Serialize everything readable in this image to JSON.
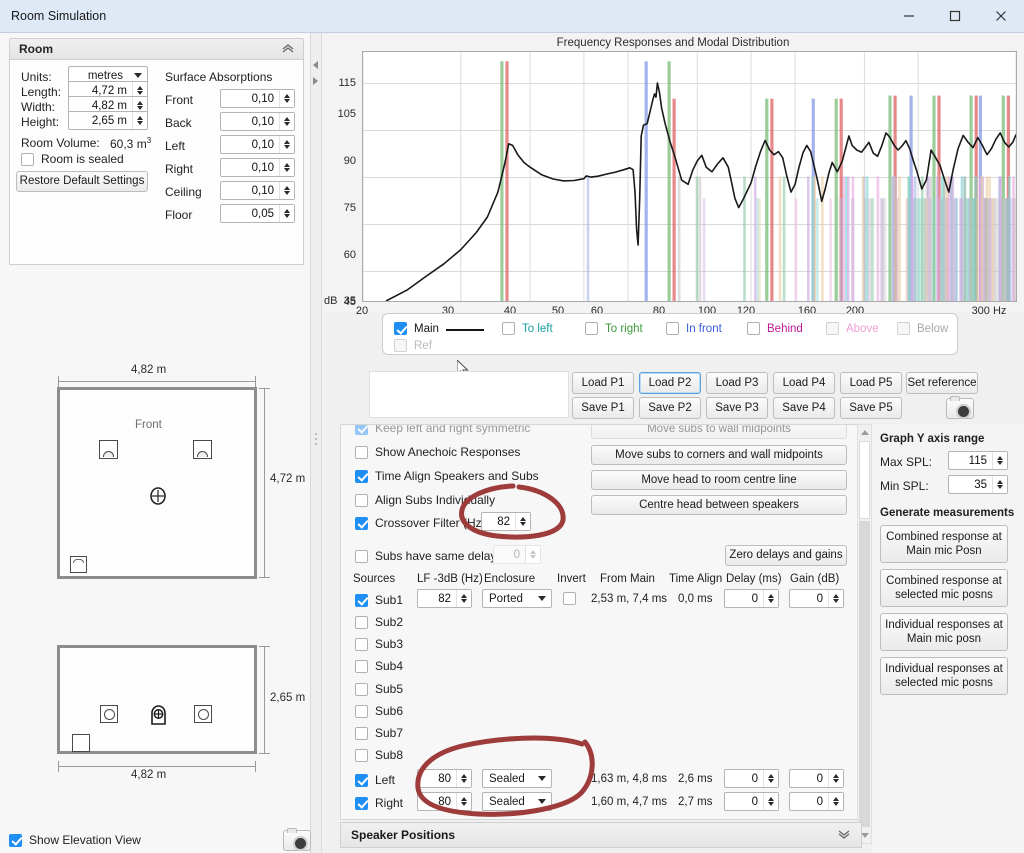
{
  "window": {
    "title": "Room Simulation",
    "minimize": "minimize-button",
    "maximize": "maximize-button",
    "close": "close-button"
  },
  "room_group": {
    "title": "Room",
    "collapse_icon": "chevron-up-icon",
    "units_label": "Units:",
    "units_value": "metres",
    "length_label": "Length:",
    "length_value": "4,72 m",
    "width_label": "Width:",
    "width_value": "4,82 m",
    "height_label": "Height:",
    "height_value": "2,65 m",
    "volume_label": "Room Volume:",
    "volume_value": "60,3 m",
    "volume_exp": "3",
    "sealed_label": "Room is sealed",
    "sealed_checked": false,
    "restore_label": "Restore Default Settings",
    "absorptions_title": "Surface Absorptions",
    "absorptions": [
      {
        "label": "Front",
        "value": "0,10"
      },
      {
        "label": "Back",
        "value": "0,10"
      },
      {
        "label": "Left",
        "value": "0,10"
      },
      {
        "label": "Right",
        "value": "0,10"
      },
      {
        "label": "Ceiling",
        "value": "0,10"
      },
      {
        "label": "Floor",
        "value": "0,05"
      }
    ]
  },
  "plan_view": {
    "width_dim": "4,82 m",
    "depth_dim": "4,72 m",
    "front_label": "Front"
  },
  "elevation_view": {
    "height_dim": "2,65 m",
    "width_dim": "4,82 m"
  },
  "show_elevation": {
    "label": "Show Elevation View",
    "checked": true
  },
  "chart_data": {
    "type": "line",
    "title": "Frequency Responses and Modal Distribution",
    "xlabel": "",
    "ylabel": "dB",
    "x_unit": "Hz",
    "xscale": "log",
    "xlim": [
      20,
      300
    ],
    "ylim": [
      35,
      115
    ],
    "grid": true,
    "yticks": [
      115,
      105,
      90,
      75,
      60,
      45,
      35
    ],
    "xticks": [
      20,
      30,
      40,
      50,
      60,
      80,
      100,
      120,
      160,
      200,
      300
    ],
    "xtick_labels": [
      "20",
      "30",
      "40",
      "50",
      "60",
      "80",
      "100",
      "120",
      "160",
      "200",
      "300 Hz"
    ],
    "series": [
      {
        "name": "Main",
        "color": "#1a1a1a",
        "x": [
          22,
          24,
          26,
          28,
          30,
          32,
          33.5,
          35,
          36,
          36.6,
          37.2,
          38,
          39,
          40,
          42,
          44,
          46,
          48,
          50,
          50.5,
          51.5,
          53,
          55,
          57,
          59,
          60.5,
          61.3,
          61.8,
          62.2,
          62.6,
          63,
          63.4,
          64,
          65,
          66,
          66.6,
          67,
          67.4,
          67.8,
          68.4,
          69,
          70,
          71.5,
          73,
          75,
          77,
          78.5,
          80,
          81.5,
          83,
          85,
          87,
          89,
          91,
          92.5,
          93.5,
          95,
          97,
          100,
          102,
          104,
          106,
          108,
          110,
          112,
          114,
          116,
          118,
          120,
          122,
          124,
          126,
          128,
          130,
          132,
          134,
          136,
          138,
          140,
          143,
          146,
          148,
          150,
          152,
          155,
          158,
          160,
          163,
          166,
          169,
          172,
          175,
          178,
          181,
          184,
          187,
          190,
          193,
          196,
          199,
          203,
          207,
          211,
          215,
          219,
          223,
          227,
          231,
          236,
          241,
          246,
          251,
          256,
          261,
          266,
          271,
          276,
          281,
          286,
          291,
          296,
          300
        ],
        "y": [
          35,
          38.5,
          43,
          47,
          51.5,
          57,
          62,
          70,
          79,
          85.5,
          85,
          82,
          79.5,
          78,
          75.5,
          74.2,
          73.6,
          73.7,
          74.3,
          75.2,
          74.8,
          75.1,
          75.8,
          76.4,
          77.2,
          77.8,
          77.2,
          70,
          58,
          53,
          68,
          88,
          91.5,
          92,
          97,
          100,
          101.5,
          100.5,
          105,
          102,
          97,
          92,
          86,
          81,
          73.8,
          72.5,
          77,
          80,
          81.8,
          78,
          76.5,
          79,
          81,
          78,
          72,
          68,
          65,
          68,
          73,
          78.5,
          83,
          86.6,
          83.5,
          82,
          83,
          81,
          75,
          70,
          72.5,
          78,
          82.6,
          85,
          83,
          78,
          73,
          67,
          71,
          76,
          79.5,
          76.5,
          80,
          84,
          88,
          85,
          83.5,
          82.8,
          84,
          86,
          82.5,
          81.5,
          85,
          89,
          87.5,
          85,
          83.5,
          84.8,
          86.5,
          84,
          80,
          76.5,
          71,
          74,
          83.5,
          81,
          78.5,
          74,
          70,
          77,
          84,
          88.2,
          86,
          84.3,
          87.5,
          85,
          82,
          84,
          87,
          89,
          86,
          84.5,
          86,
          88.5,
          87.5
        ]
      }
    ],
    "modes_note": "Vertical coloured bars = room modal distribution (axial red/green/blue, tangential & oblique in pastel colours)"
  },
  "legend": {
    "items": [
      {
        "label": "Main",
        "color": "#111111",
        "checked": true,
        "enabled": true,
        "line": true
      },
      {
        "label": "To left",
        "color": "#16a2a2",
        "checked": false,
        "enabled": true,
        "line": false
      },
      {
        "label": "To right",
        "color": "#3d9b3d",
        "checked": false,
        "enabled": true,
        "line": false
      },
      {
        "label": "In front",
        "color": "#3b5bd9",
        "checked": false,
        "enabled": true,
        "line": false
      },
      {
        "label": "Behind",
        "color": "#c0189a",
        "checked": false,
        "enabled": true,
        "line": false
      },
      {
        "label": "Above",
        "color": "#f29ad6",
        "checked": false,
        "enabled": false,
        "line": false
      },
      {
        "label": "Below",
        "color": "#9b9b9b",
        "checked": false,
        "enabled": false,
        "line": false
      },
      {
        "label": "Ref",
        "color": "#b3b3b3",
        "checked": false,
        "enabled": false,
        "line": false
      }
    ]
  },
  "preset_buttons": {
    "load": [
      "Load P1",
      "Load P2",
      "Load P3",
      "Load P4",
      "Load P5"
    ],
    "save": [
      "Save P1",
      "Save P2",
      "Save P3",
      "Save P4",
      "Save P5"
    ],
    "set_reference": "Set reference",
    "selected_load": "Load P2",
    "camera_icon": "camera-icon"
  },
  "settings": {
    "keep_symmetric": {
      "label": "Keep left and right symmetric",
      "checked": true
    },
    "show_anechoic": {
      "label": "Show Anechoic Responses",
      "checked": false
    },
    "time_align": {
      "label": "Time Align Speakers and Subs",
      "checked": true
    },
    "align_individually": {
      "label": "Align Subs Individually",
      "checked": false
    },
    "crossover": {
      "label": "Crossover Filter (Hz)",
      "checked": true,
      "value": "82"
    },
    "same_delay": {
      "label": "Subs have same delay",
      "checked": false,
      "value": "0"
    },
    "buttons": [
      "Move subs to wall midpoints",
      "Move subs to corners and wall midpoints",
      "Move head to room centre line",
      "Centre head between speakers"
    ],
    "zero_delays": "Zero delays and gains"
  },
  "sources_table": {
    "headers": [
      "Sources",
      "LF -3dB (Hz)",
      "Enclosure",
      "Invert",
      "From Main",
      "Time Align",
      "Delay (ms)",
      "Gain (dB)"
    ],
    "rows": [
      {
        "name": "Sub1",
        "checked": true,
        "lf": "82",
        "enclosure": "Ported",
        "invert": false,
        "from_main": "2,53 m, 7,4 ms",
        "time_align": "0,0 ms",
        "delay": "0",
        "gain": "0",
        "has_controls": true
      },
      {
        "name": "Sub2",
        "checked": false,
        "has_controls": false
      },
      {
        "name": "Sub3",
        "checked": false,
        "has_controls": false
      },
      {
        "name": "Sub4",
        "checked": false,
        "has_controls": false
      },
      {
        "name": "Sub5",
        "checked": false,
        "has_controls": false
      },
      {
        "name": "Sub6",
        "checked": false,
        "has_controls": false
      },
      {
        "name": "Sub7",
        "checked": false,
        "has_controls": false
      },
      {
        "name": "Sub8",
        "checked": false,
        "has_controls": false
      },
      {
        "name": "Left",
        "checked": true,
        "lf": "80",
        "enclosure": "Sealed",
        "invert": null,
        "from_main": "1,63 m, 4,8 ms",
        "time_align": "2,6 ms",
        "delay": "0",
        "gain": "0",
        "has_controls": true
      },
      {
        "name": "Right",
        "checked": true,
        "lf": "80",
        "enclosure": "Sealed",
        "invert": null,
        "from_main": "1,60 m, 4,7 ms",
        "time_align": "2,7 ms",
        "delay": "0",
        "gain": "0",
        "has_controls": true
      }
    ]
  },
  "speaker_positions": {
    "title": "Speaker Positions",
    "expand_icon": "chevron-down-icon"
  },
  "right_panel": {
    "y_axis_title": "Graph Y axis range",
    "max_spl_label": "Max SPL:",
    "max_spl_value": "115",
    "min_spl_label": "Min SPL:",
    "min_spl_value": "35",
    "generate_title": "Generate measurements",
    "buttons": [
      "Combined response at\nMain mic Posn",
      "Combined response at\nselected mic posns",
      "Individual responses at\nMain mic posn",
      "Individual responses at\nselected mic posns"
    ]
  },
  "annotations": {
    "color": "#9e3b3b",
    "shapes": [
      "circle-around-crossover-filter",
      "circle-around-left-right-lf"
    ]
  }
}
